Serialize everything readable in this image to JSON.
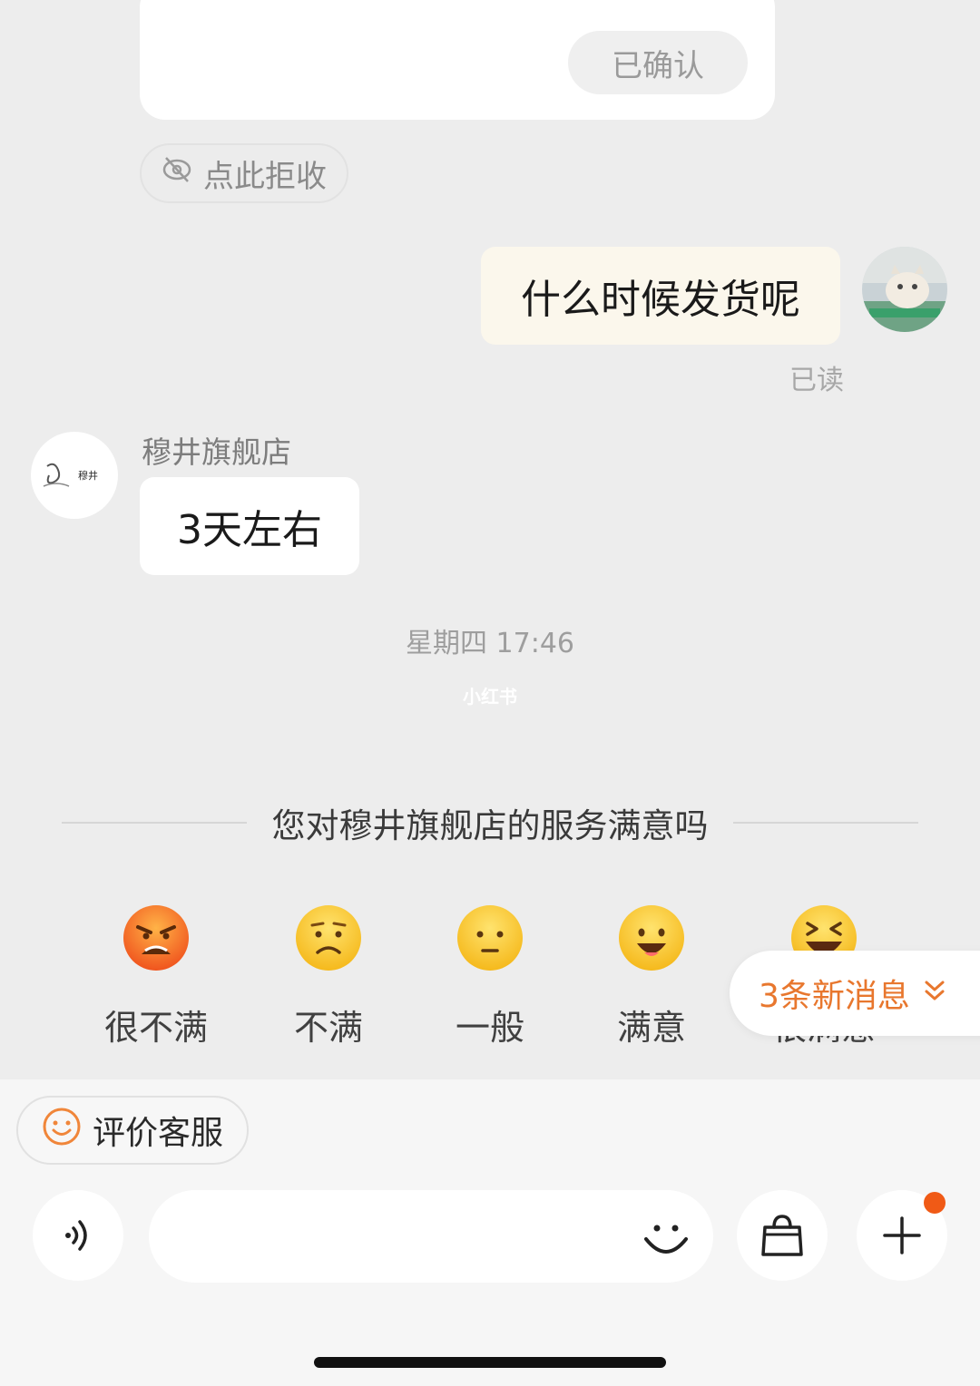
{
  "top_card": {
    "confirm_label": "已确认"
  },
  "reject": {
    "label": "点此拒收",
    "icon": "eye-off-icon"
  },
  "messages": {
    "outgoing": {
      "text": "什么时候发货呢",
      "status": "已读"
    },
    "incoming": {
      "shop_name": "穆井旗舰店",
      "text": "3天左右",
      "logo_text": "穆井"
    }
  },
  "timestamp": "星期四 17:46",
  "watermark": "小红书",
  "satisfaction": {
    "question": "您对穆井旗舰店的服务满意吗",
    "options": [
      {
        "label": "很不满",
        "icon": "angry-face-icon"
      },
      {
        "label": "不满",
        "icon": "frown-face-icon"
      },
      {
        "label": "一般",
        "icon": "neutral-face-icon"
      },
      {
        "label": "满意",
        "icon": "smile-face-icon"
      },
      {
        "label": "很满意",
        "icon": "laugh-face-icon"
      }
    ]
  },
  "new_messages": {
    "label": "3条新消息",
    "icon": "double-chevron-down-icon"
  },
  "bottom_bar": {
    "rate_service_label": "评价客服",
    "input_placeholder": "",
    "voice_icon": "voice-icon",
    "emoji_icon": "emoji-icon",
    "bag_icon": "shopping-bag-icon",
    "plus_icon": "plus-icon"
  },
  "colors": {
    "accent": "#e8772e",
    "background": "#ededed",
    "my_bubble": "#fbf7ec",
    "badge": "#f05a16"
  }
}
